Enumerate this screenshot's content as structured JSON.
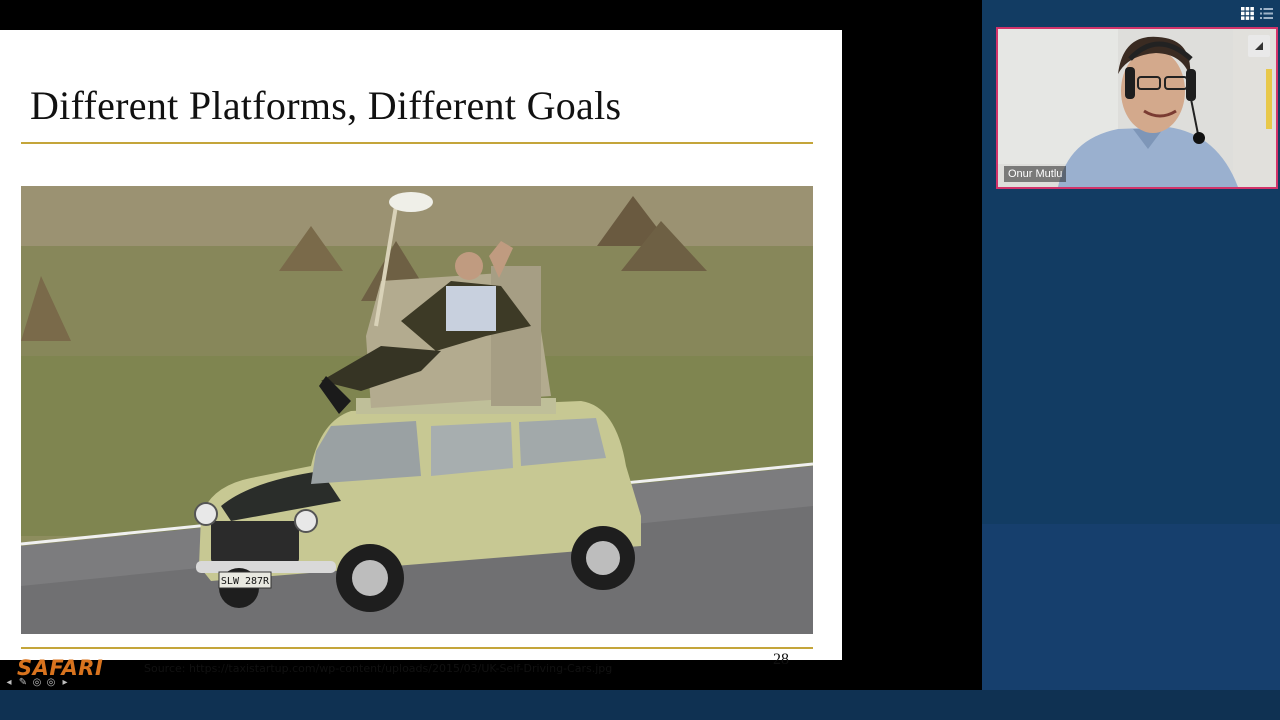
{
  "slide": {
    "title": "Different Platforms, Different Goals",
    "logo": "SAFARI",
    "source": "Source: https://taxistartup.com/wp-content/uploads/2015/03/UK-Self-Driving-Cars.jpg",
    "page_number": "28",
    "photo_plate": "SLW 287R",
    "nav_icons": [
      "arrow-left-icon",
      "pen-icon",
      "zoom-icon",
      "menu-icon",
      "arrow-right-icon"
    ],
    "nav_glyphs": [
      "◂",
      "✎",
      "◎",
      "◎",
      "▸"
    ],
    "accent_color": "#c4a53a",
    "logo_color": "#d8731e"
  },
  "video": {
    "participant_name": "Onur Mutlu",
    "tile_border_color": "#d2336a",
    "menu_icon": "expand-icon"
  },
  "view_controls": {
    "grid_icon": "grid-view-icon",
    "list_icon": "list-view-icon"
  },
  "colors": {
    "panel_bg": "#123c63",
    "bottom_bar": "#0f3152"
  }
}
